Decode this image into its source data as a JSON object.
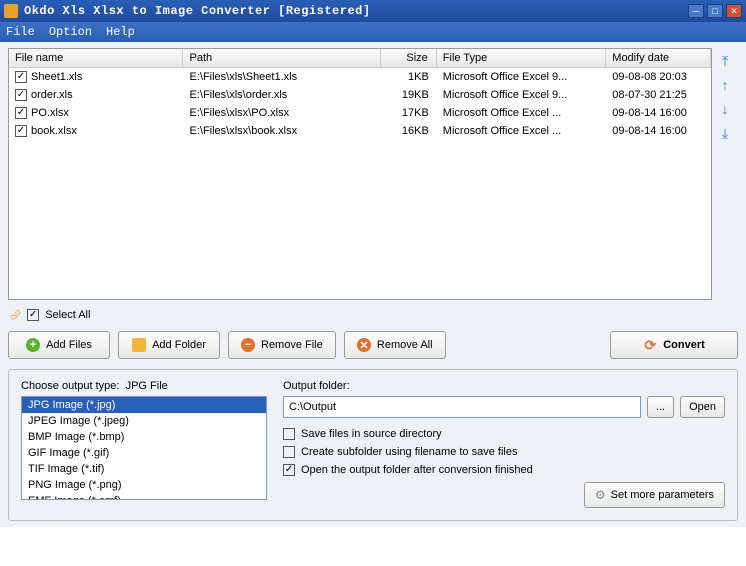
{
  "title": "Okdo Xls Xlsx to Image Converter [Registered]",
  "menu": {
    "file": "File",
    "option": "Option",
    "help": "Help"
  },
  "columns": {
    "name": "File name",
    "path": "Path",
    "size": "Size",
    "type": "File Type",
    "date": "Modify date"
  },
  "files": [
    {
      "name": "Sheet1.xls",
      "path": "E:\\Files\\xls\\Sheet1.xls",
      "size": "1KB",
      "type": "Microsoft Office Excel 9...",
      "date": "09-08-08 20:03",
      "checked": true
    },
    {
      "name": "order.xls",
      "path": "E:\\Files\\xls\\order.xls",
      "size": "19KB",
      "type": "Microsoft Office Excel 9...",
      "date": "08-07-30 21:25",
      "checked": true
    },
    {
      "name": "PO.xlsx",
      "path": "E:\\Files\\xlsx\\PO.xlsx",
      "size": "17KB",
      "type": "Microsoft Office Excel ...",
      "date": "09-08-14 16:00",
      "checked": true
    },
    {
      "name": "book.xlsx",
      "path": "E:\\Files\\xlsx\\book.xlsx",
      "size": "16KB",
      "type": "Microsoft Office Excel ...",
      "date": "09-08-14 16:00",
      "checked": true
    }
  ],
  "selectAll": {
    "label": "Select All",
    "checked": true
  },
  "buttons": {
    "addFiles": "Add Files",
    "addFolder": "Add Folder",
    "removeFile": "Remove File",
    "removeAll": "Remove All",
    "convert": "Convert"
  },
  "outputType": {
    "label": "Choose output type:",
    "current": "JPG File",
    "options": [
      "JPG Image (*.jpg)",
      "JPEG Image (*.jpeg)",
      "BMP Image (*.bmp)",
      "GIF Image (*.gif)",
      "TIF Image (*.tif)",
      "PNG Image (*.png)",
      "EMF Image (*.emf)"
    ],
    "selectedIndex": 0
  },
  "outputFolder": {
    "label": "Output folder:",
    "value": "C:\\Output",
    "browse": "...",
    "open": "Open"
  },
  "options": {
    "saveInSource": {
      "label": "Save files in source directory",
      "checked": false
    },
    "createSubfolder": {
      "label": "Create subfolder using filename to save files",
      "checked": false
    },
    "openAfter": {
      "label": "Open the output folder after conversion finished",
      "checked": true
    }
  },
  "moreParams": "Set more parameters"
}
